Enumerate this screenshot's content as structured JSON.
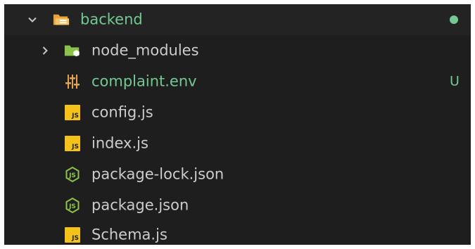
{
  "explorer": {
    "folder": {
      "name": "backend",
      "icon": "folder-open-icon",
      "status_color": "#73c991"
    },
    "items": [
      {
        "name": "node_modules",
        "type": "folder",
        "icon": "folder-icon"
      },
      {
        "name": "complaint.env",
        "type": "file",
        "icon": "env-settings-icon",
        "status": "U",
        "color": "#73c991"
      },
      {
        "name": "config.js",
        "type": "file",
        "icon": "js-file-icon",
        "badge": "JS"
      },
      {
        "name": "index.js",
        "type": "file",
        "icon": "js-file-icon",
        "badge": "JS"
      },
      {
        "name": "package-lock.json",
        "type": "file",
        "icon": "nodejs-icon"
      },
      {
        "name": "package.json",
        "type": "file",
        "icon": "nodejs-icon"
      },
      {
        "name": "Schema.js",
        "type": "file",
        "icon": "js-file-icon",
        "badge": "JS"
      }
    ]
  },
  "colors": {
    "background": "#1e1e1e",
    "text": "#cccccc",
    "git_untracked": "#73c991",
    "js_badge": "#f5c21b",
    "folder_green": "#8bc34a"
  }
}
